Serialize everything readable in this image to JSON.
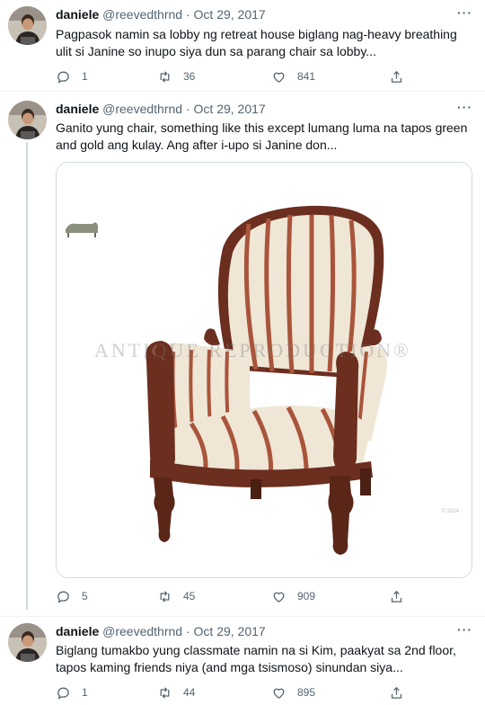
{
  "tweets": [
    {
      "name": "daniele",
      "handle": "@reevedthrnd",
      "sep": "·",
      "date": "Oct 29, 2017",
      "text": "Pagpasok namin sa lobby ng retreat house biglang nag-heavy breathing ulit si Janine so inupo siya dun sa parang chair sa lobby...",
      "replies": "1",
      "retweets": "36",
      "likes": "841"
    },
    {
      "name": "daniele",
      "handle": "@reevedthrnd",
      "sep": "·",
      "date": "Oct 29, 2017",
      "text": "Ganito yung chair, something like this except lumang luma na tapos green and gold ang kulay. Ang after i-upo si Janine don...",
      "replies": "5",
      "retweets": "45",
      "likes": "909"
    },
    {
      "name": "daniele",
      "handle": "@reevedthrnd",
      "sep": "·",
      "date": "Oct 29, 2017",
      "text": "Biglang tumakbo yung classmate namin na si Kim, paakyat sa 2nd floor, tapos kaming friends niya (and mga tsismoso) sinundan siya...",
      "replies": "1",
      "retweets": "44",
      "likes": "895"
    }
  ],
  "more_label": "···",
  "media": {
    "watermark": "ANTIQUE REPRODUCTION®",
    "copyright": "© 2014"
  },
  "colors": {
    "chair_wood": "#6b2e1f",
    "chair_stripe": "#a9553b",
    "chair_fabric": "#efe6d6",
    "secondary_text": "#536471"
  },
  "icons": [
    "reply-icon",
    "retweet-icon",
    "like-icon",
    "share-icon",
    "more-icon"
  ]
}
